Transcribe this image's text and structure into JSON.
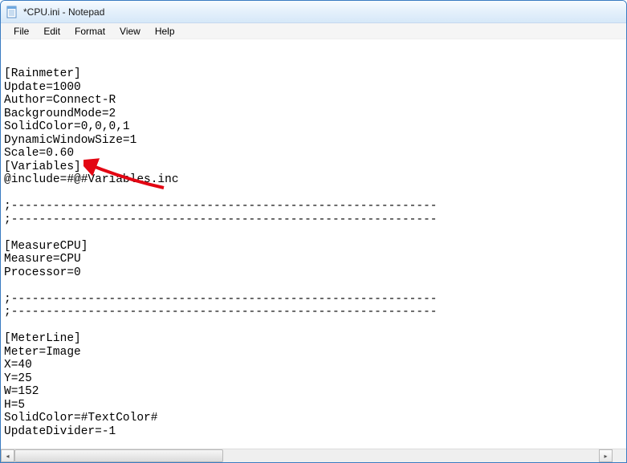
{
  "window": {
    "title": "*CPU.ini - Notepad"
  },
  "menu": {
    "file": "File",
    "edit": "Edit",
    "format": "Format",
    "view": "View",
    "help": "Help"
  },
  "content": {
    "lines": [
      "[Rainmeter]",
      "Update=1000",
      "Author=Connect-R",
      "BackgroundMode=2",
      "SolidColor=0,0,0,1",
      "DynamicWindowSize=1",
      "Scale=0.60",
      "[Variables]",
      "@include=#@#Variables.inc",
      "",
      ";-------------------------------------------------------------",
      ";-------------------------------------------------------------",
      "",
      "[MeasureCPU]",
      "Measure=CPU",
      "Processor=0",
      "",
      ";-------------------------------------------------------------",
      ";-------------------------------------------------------------",
      "",
      "[MeterLine]",
      "Meter=Image",
      "X=40",
      "Y=25",
      "W=152",
      "H=5",
      "SolidColor=#TextColor#",
      "UpdateDivider=-1"
    ]
  },
  "annotation": {
    "arrow_color": "#e30613"
  }
}
